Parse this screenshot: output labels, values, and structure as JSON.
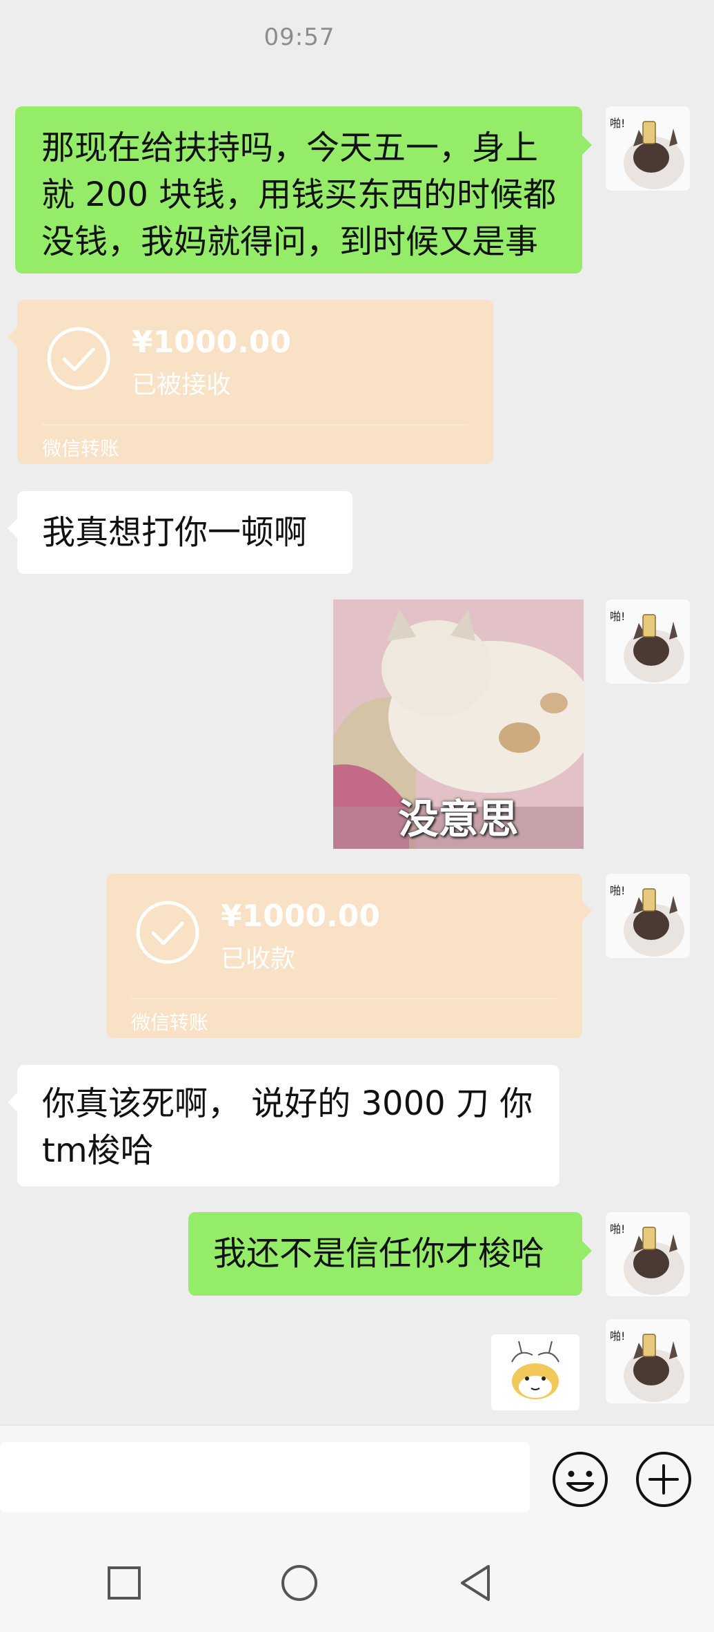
{
  "status": {
    "time": "09:57"
  },
  "messages": {
    "m1": {
      "lines": [
        "那现在给扶持吗，今天五一，身上",
        "就 200 块钱，用钱买东西的时候都",
        "没钱，我妈就得问，到时候又是事"
      ]
    },
    "t1": {
      "amount": "¥1000.00",
      "status": "已被接收",
      "label": "微信转账"
    },
    "m2": {
      "text": "我真想打你一顿啊"
    },
    "photo": {
      "caption": "没意思"
    },
    "t2": {
      "amount": "¥1000.00",
      "status": "已收款",
      "label": "微信转账"
    },
    "m3": {
      "lines": [
        "你真该死啊， 说好的 3000 刀 你",
        "tm梭哈"
      ]
    },
    "m4": {
      "text": "我还不是信任你才梭哈"
    }
  },
  "avatar": {
    "label": "啪!"
  },
  "icons": {
    "emoji": "emoji-icon",
    "more": "plus-icon",
    "nav": [
      "recent-apps-icon",
      "home-icon",
      "back-icon"
    ]
  },
  "colors": {
    "green_bubble": "#95ec69",
    "transfer": "#f8e1c4",
    "background": "#ededed"
  }
}
